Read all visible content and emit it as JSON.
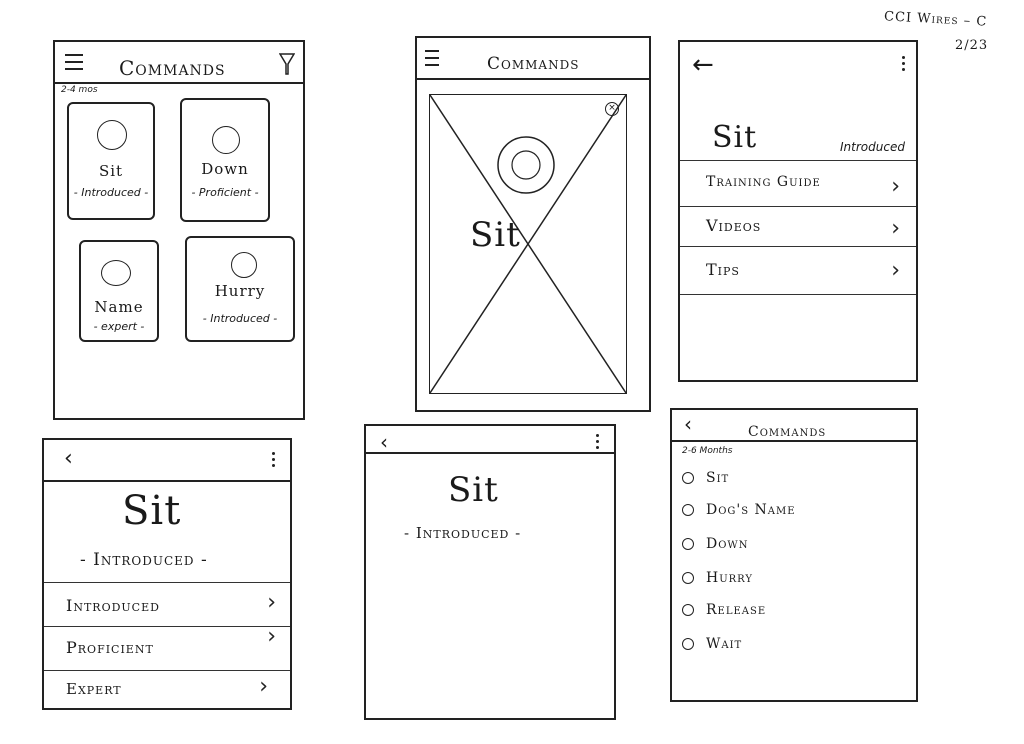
{
  "corner_note": {
    "line1": "CCI Wires – C",
    "line2": "2/23"
  },
  "screen1": {
    "title": "Commands",
    "age_label": "2-4 mos",
    "cards": [
      {
        "name": "Sit",
        "status": "- Introduced -"
      },
      {
        "name": "Down",
        "status": "- Proficient -"
      },
      {
        "name": "Name",
        "status": "- expert -"
      },
      {
        "name": "Hurry",
        "status": "- Introduced -"
      }
    ]
  },
  "screen2": {
    "title": "Commands",
    "overlay_text": "Sit"
  },
  "screen3": {
    "name": "Sit",
    "status": "Introduced",
    "menu": [
      {
        "label": "Training Guide"
      },
      {
        "label": "Videos"
      },
      {
        "label": "Tips"
      }
    ]
  },
  "screen4": {
    "name": "Sit",
    "status": "- Introduced -",
    "levels": [
      {
        "label": "Introduced"
      },
      {
        "label": "Proficient"
      },
      {
        "label": "Expert"
      }
    ]
  },
  "screen5": {
    "name": "Sit",
    "status": "- Introduced -"
  },
  "screen6": {
    "title": "Commands",
    "age_label": "2-6 Months",
    "items": [
      {
        "label": "Sit"
      },
      {
        "label": "Dog's Name"
      },
      {
        "label": "Down"
      },
      {
        "label": "Hurry"
      },
      {
        "label": "Release"
      },
      {
        "label": "Wait"
      }
    ]
  },
  "icons": {
    "menu": "hamburger-icon",
    "filter": "filter-icon",
    "back": "back-arrow-icon",
    "more": "kebab-icon",
    "chevron": "chevron-right-icon",
    "close": "close-icon",
    "image_placeholder": "image-placeholder-icon"
  }
}
